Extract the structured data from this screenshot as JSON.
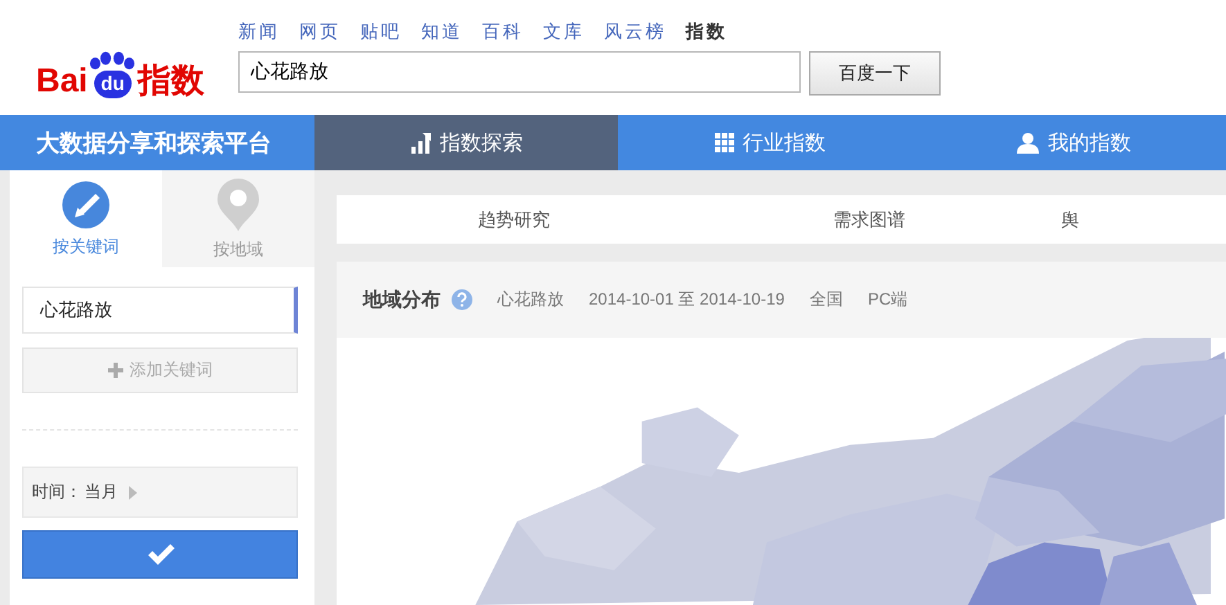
{
  "logo": {
    "left": "Bai",
    "paw": "du",
    "right": "指数"
  },
  "top_links": [
    {
      "label": "新闻",
      "selected": false
    },
    {
      "label": "网页",
      "selected": false
    },
    {
      "label": "贴吧",
      "selected": false
    },
    {
      "label": "知道",
      "selected": false
    },
    {
      "label": "百科",
      "selected": false
    },
    {
      "label": "文库",
      "selected": false
    },
    {
      "label": "风云榜",
      "selected": false
    },
    {
      "label": "指数",
      "selected": true
    }
  ],
  "search": {
    "value": "心花路放",
    "button": "百度一下"
  },
  "nav": {
    "slogan": "大数据分享和探索平台",
    "tabs": [
      {
        "label": "指数探索",
        "kind": "chart",
        "selected": true
      },
      {
        "label": "行业指数",
        "kind": "grid",
        "selected": false
      },
      {
        "label": "我的指数",
        "kind": "person",
        "selected": false
      }
    ]
  },
  "sidebar": {
    "tabs": [
      {
        "label": "按关键词",
        "kind": "keyword",
        "selected": true
      },
      {
        "label": "按地域",
        "kind": "region",
        "selected": false
      }
    ],
    "keyword": "心花路放",
    "add_keyword": "添加关键词",
    "time_label": "时间：",
    "time_value": "当月"
  },
  "subtabs": [
    {
      "label": "趋势研究"
    },
    {
      "label": "需求图谱"
    },
    {
      "label": "舆"
    }
  ],
  "panel": {
    "title": "地域分布",
    "keyword": "心花路放",
    "date_range": "2014-10-01 至 2014-10-19",
    "region": "全国",
    "device": "PC端"
  }
}
